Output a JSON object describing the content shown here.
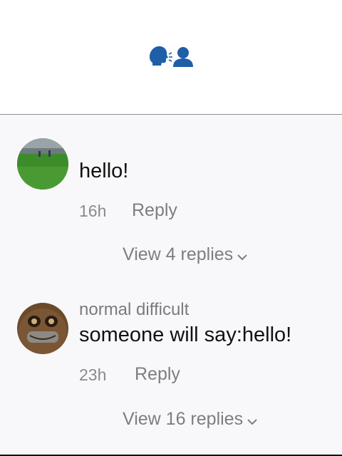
{
  "header": {
    "icon": "speaking-head-and-bust-emoji"
  },
  "comments": [
    {
      "username": "",
      "text": "hello!",
      "time": "16h",
      "reply_label": "Reply",
      "view_replies_label": "View 4 replies",
      "avatar": "green-field-photo"
    },
    {
      "username": "normal difficult",
      "text": "someone will say:hello!",
      "time": "23h",
      "reply_label": "Reply",
      "view_replies_label": "View 16 replies",
      "avatar": "brown-face-photo"
    }
  ],
  "colors": {
    "list_background": "#f8f8fa",
    "secondary_text": "#7e7e82",
    "primary_text": "#111111",
    "emoji_blue": "#1f5fa8"
  }
}
